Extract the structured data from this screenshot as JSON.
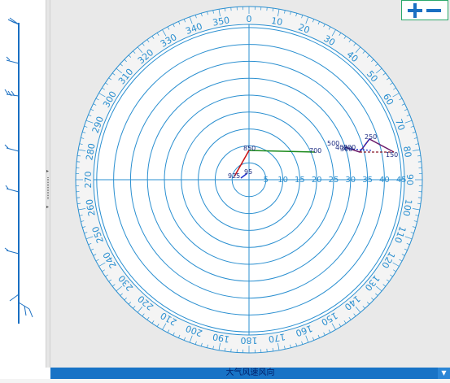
{
  "rose": {
    "outer_ticks": [
      "0",
      "10",
      "20",
      "30",
      "40",
      "50",
      "60",
      "70",
      "80",
      "90",
      "100",
      "110",
      "120",
      "130",
      "140",
      "150",
      "160",
      "170",
      "180",
      "190",
      "200",
      "210",
      "220",
      "230",
      "240",
      "250",
      "260",
      "270",
      "280",
      "290",
      "300",
      "310",
      "320",
      "330",
      "340",
      "350"
    ],
    "radial_labels": [
      "5",
      "10",
      "15",
      "20",
      "25",
      "30",
      "35",
      "40",
      "45"
    ],
    "height_labels": [
      {
        "text": "850"
      },
      {
        "text": "700"
      },
      {
        "text": "500"
      },
      {
        "text": "400"
      },
      {
        "text": "300"
      },
      {
        "text": "250"
      },
      {
        "text": "200"
      },
      {
        "text": "150"
      },
      {
        "text": "925"
      },
      {
        "text": "95"
      }
    ],
    "colors": {
      "ring": "#2a8fd0",
      "panel": "#e9e9e9",
      "face": "#ffffff",
      "bar": "#1873c6"
    }
  },
  "bottom_bar": {
    "label": "大气风速风向"
  },
  "zoom": {
    "plus_icon": "plus-icon",
    "minus_icon": "minus-icon"
  }
}
